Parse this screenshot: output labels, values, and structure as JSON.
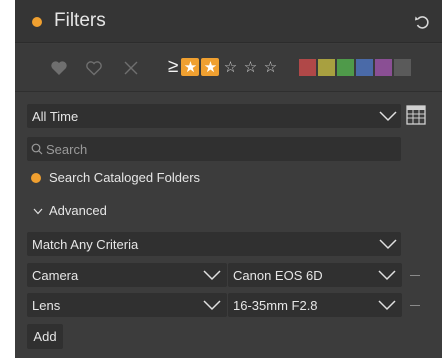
{
  "header": {
    "title": "Filters",
    "accent_color": "#f0a030"
  },
  "flags": {
    "items": [
      "filled-heart-icon",
      "outline-heart-icon",
      "reject-x-icon"
    ]
  },
  "rating": {
    "operator": "≥",
    "selected": 2,
    "max": 5,
    "filled_color": "#f0a030"
  },
  "color_labels": {
    "items": [
      "#b04848",
      "#a8a040",
      "#4f9a4a",
      "#4a6aa8",
      "#8a4f94",
      "#5a5a5a"
    ]
  },
  "date_filter": {
    "selected": "All Time"
  },
  "search": {
    "placeholder": "Search",
    "value": ""
  },
  "cataloged": {
    "label": "Search Cataloged Folders"
  },
  "advanced": {
    "label": "Advanced",
    "match": "Match Any Criteria",
    "rules": [
      {
        "field": "Camera",
        "value": "Canon EOS 6D"
      },
      {
        "field": "Lens",
        "value": "16-35mm F2.8"
      }
    ],
    "add_label": "Add"
  }
}
